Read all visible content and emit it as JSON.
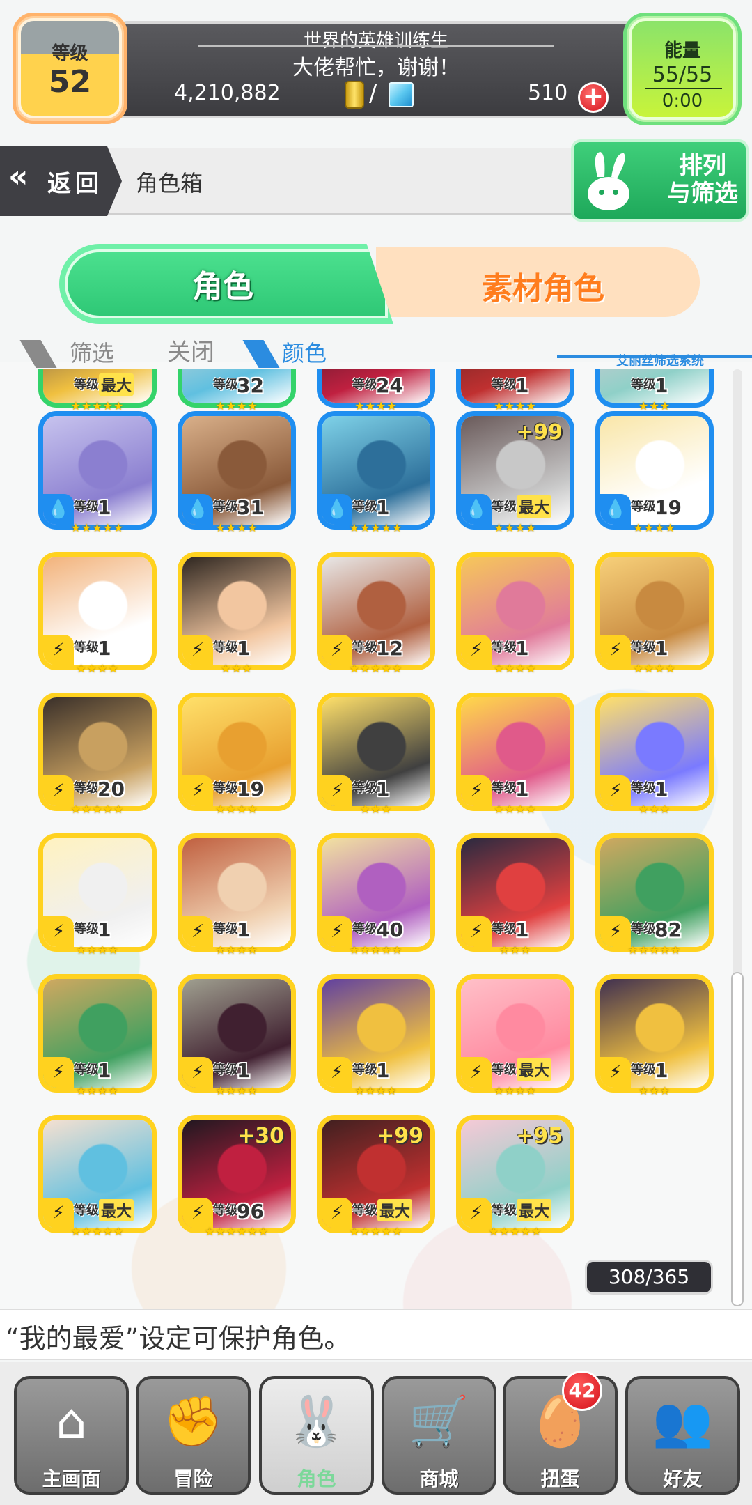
{
  "header": {
    "level_label": "等级",
    "level_value": "52",
    "player_name": "世界的英雄训练生",
    "player_msg": "大佬帮忙，谢谢！",
    "gold": "4,210,882",
    "slash": "/",
    "gems": "510",
    "plus_label": "+",
    "energy_label": "能量",
    "energy_value": "55/55",
    "energy_timer": "0:00"
  },
  "titlebar": {
    "back_chevron": "«",
    "back_label": "返回",
    "title": "角色箱",
    "sort_label_1": "排列",
    "sort_label_2": "与筛选"
  },
  "tabs": {
    "active": "角色",
    "inactive": "素材角色"
  },
  "filter": {
    "label": "筛选",
    "state": "关闭",
    "color": "颜色",
    "system": "艾丽丝筛选系统"
  },
  "cards": [
    {
      "frame": "green",
      "level": "最大",
      "stars": "★★★★★"
    },
    {
      "frame": "green",
      "level": "32",
      "stars": "★★★★"
    },
    {
      "frame": "blue",
      "level": "24",
      "stars": "★★★★"
    },
    {
      "frame": "blue",
      "level": "1",
      "stars": "★★★★"
    },
    {
      "frame": "blue",
      "level": "1",
      "stars": "★★★"
    },
    {
      "frame": "blue",
      "level": "1",
      "stars": "★★★★★",
      "elem": "💧"
    },
    {
      "frame": "blue",
      "level": "31",
      "stars": "★★★★",
      "elem": "💧"
    },
    {
      "frame": "blue",
      "level": "1",
      "stars": "★★★★★",
      "elem": "💧"
    },
    {
      "frame": "blue",
      "level": "最大",
      "stars": "★★★★",
      "elem": "💧",
      "plus": "+99"
    },
    {
      "frame": "blue",
      "level": "19",
      "stars": "★★★★",
      "elem": "💧"
    },
    {
      "frame": "yellow",
      "level": "1",
      "stars": "★★★★",
      "elem": "⚡"
    },
    {
      "frame": "yellow",
      "level": "1",
      "stars": "★★★",
      "elem": "⚡"
    },
    {
      "frame": "yellow",
      "level": "12",
      "stars": "★★★★★",
      "elem": "⚡"
    },
    {
      "frame": "yellow",
      "level": "1",
      "stars": "★★★★",
      "elem": "⚡"
    },
    {
      "frame": "yellow",
      "level": "1",
      "stars": "★★★★",
      "elem": "⚡"
    },
    {
      "frame": "yellow",
      "level": "20",
      "stars": "★★★★★",
      "elem": "⚡"
    },
    {
      "frame": "yellow",
      "level": "19",
      "stars": "★★★★",
      "elem": "⚡"
    },
    {
      "frame": "yellow",
      "level": "1",
      "stars": "★★★",
      "elem": "⚡"
    },
    {
      "frame": "yellow",
      "level": "1",
      "stars": "★★★★",
      "elem": "⚡"
    },
    {
      "frame": "yellow",
      "level": "1",
      "stars": "★★★",
      "elem": "⚡"
    },
    {
      "frame": "yellow",
      "level": "1",
      "stars": "★★★★",
      "elem": "⚡"
    },
    {
      "frame": "yellow",
      "level": "1",
      "stars": "★★★★",
      "elem": "⚡"
    },
    {
      "frame": "yellow",
      "level": "40",
      "stars": "★★★★★",
      "elem": "⚡"
    },
    {
      "frame": "yellow",
      "level": "1",
      "stars": "★★★",
      "elem": "⚡"
    },
    {
      "frame": "yellow",
      "level": "82",
      "stars": "★★★★★",
      "elem": "⚡"
    },
    {
      "frame": "yellow",
      "level": "1",
      "stars": "★★★★",
      "elem": "⚡"
    },
    {
      "frame": "yellow",
      "level": "1",
      "stars": "★★★★",
      "elem": "⚡"
    },
    {
      "frame": "yellow",
      "level": "1",
      "stars": "★★★★",
      "elem": "⚡"
    },
    {
      "frame": "yellow",
      "level": "最大",
      "stars": "★★★★",
      "elem": "⚡"
    },
    {
      "frame": "yellow",
      "level": "1",
      "stars": "★★★",
      "elem": "⚡"
    },
    {
      "frame": "yellow",
      "level": "最大",
      "stars": "★★★★★",
      "elem": "⚡"
    },
    {
      "frame": "yellow",
      "level": "96",
      "stars": "★★★★★★",
      "elem": "⚡",
      "plus": "+30"
    },
    {
      "frame": "yellow",
      "level": "最大",
      "stars": "★★★★★",
      "elem": "⚡",
      "plus": "+99"
    },
    {
      "frame": "yellow",
      "level": "最大",
      "stars": "★★★★★",
      "elem": "⚡",
      "plus": "+95"
    }
  ],
  "level_tag": "等级",
  "count": "308/365",
  "hint": "“我的最爱”设定可保护角色。",
  "nav": [
    {
      "label": "主画面",
      "icon": "⌂",
      "name": "home"
    },
    {
      "label": "冒险",
      "icon": "✊",
      "name": "adventure"
    },
    {
      "label": "角色",
      "icon": "🐰",
      "name": "characters"
    },
    {
      "label": "商城",
      "icon": "🛒",
      "name": "shop"
    },
    {
      "label": "扭蛋",
      "icon": "🥚",
      "name": "gacha",
      "badge": "42"
    },
    {
      "label": "好友",
      "icon": "👥",
      "name": "friends"
    }
  ],
  "colors": {
    "yellow_frame": "#ffd21f",
    "blue_frame": "#1f8ef0",
    "green_frame": "#34d36a",
    "tab_active": "#2fc876",
    "tab_inactive_text": "#ff7d1e"
  }
}
